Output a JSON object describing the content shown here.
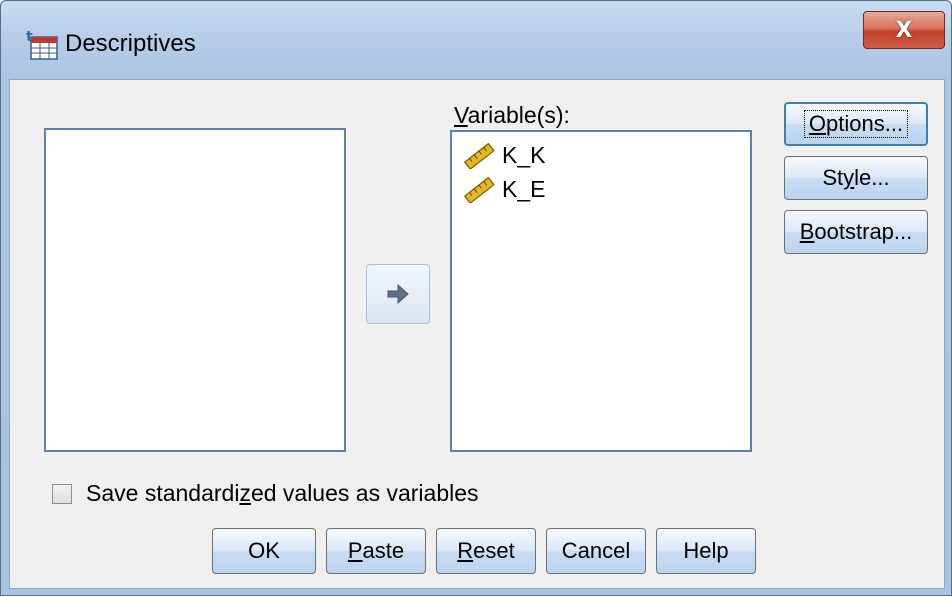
{
  "window": {
    "title": "Descriptives",
    "close_glyph": "X",
    "app_icon": "spss-dialog-icon"
  },
  "source_list": {
    "items": []
  },
  "variables": {
    "label_prefix": "",
    "label_mnemonic": "V",
    "label_rest": "ariable(s):",
    "items": [
      {
        "name": "K_K",
        "icon": "scale-ruler-icon"
      },
      {
        "name": "K_E",
        "icon": "scale-ruler-icon"
      }
    ]
  },
  "move_button": {
    "icon": "right-arrow-icon"
  },
  "side_buttons": {
    "options": {
      "mnemonic": "O",
      "rest": "ptions..."
    },
    "style": {
      "before": "St",
      "mnemonic": "y",
      "after": "le..."
    },
    "bootstrap": {
      "mnemonic": "B",
      "rest": "ootstrap..."
    }
  },
  "save_checkbox": {
    "before": "Save standardi",
    "mnemonic": "z",
    "after": "ed values as variables",
    "checked": false
  },
  "bottom_buttons": {
    "ok": "OK",
    "paste": {
      "mnemonic": "P",
      "rest": "aste"
    },
    "reset": {
      "mnemonic": "R",
      "rest": "eset"
    },
    "cancel": "Cancel",
    "help": "Help"
  },
  "colors": {
    "title_gradient_top": "#c8dcf1",
    "client_bg": "#f0f0f0",
    "list_border": "#5f82a6",
    "close_red": "#c3402a"
  }
}
